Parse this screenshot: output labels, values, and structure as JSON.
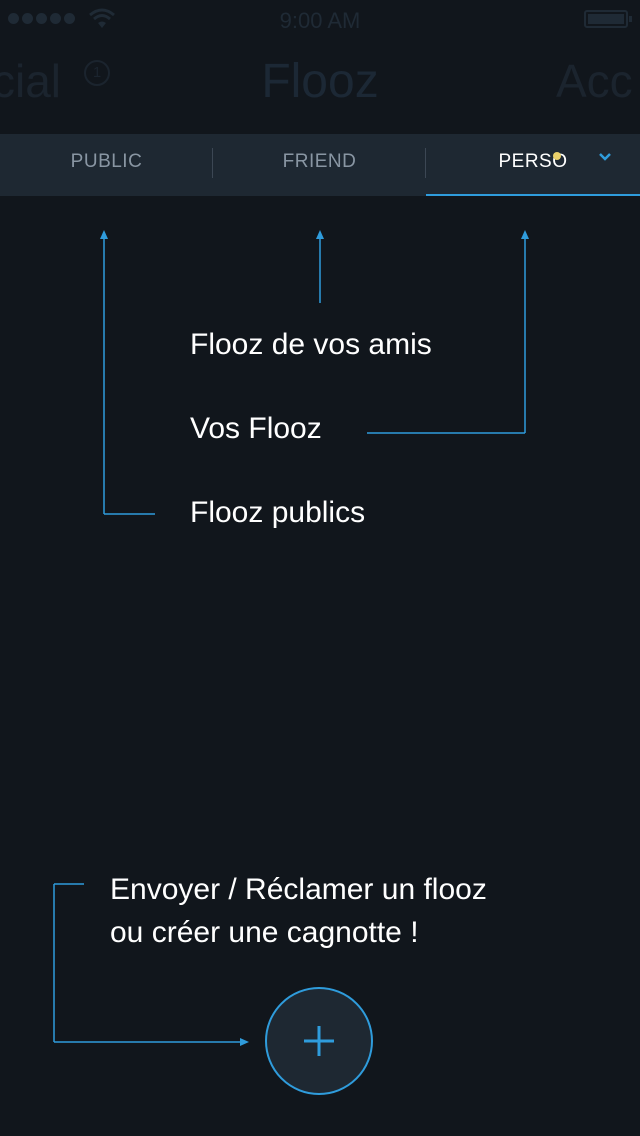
{
  "status_bar": {
    "time": "9:00 AM",
    "signal_icon": "signal-dots-icon",
    "wifi_icon": "wifi-icon",
    "battery_icon": "battery-icon"
  },
  "nav": {
    "left_partial": "cial",
    "left_badge": "1",
    "title": "Flooz",
    "right_partial": "Acc"
  },
  "tabs": [
    {
      "label": "PUBLIC",
      "active": false
    },
    {
      "label": "FRIEND",
      "active": false
    },
    {
      "label": "PERSO",
      "active": true
    }
  ],
  "tips": {
    "friends": "Flooz de vos amis",
    "yours": "Vos Flooz",
    "publics": "Flooz publics",
    "create_line1": "Envoyer / Réclamer un flooz",
    "create_line2": "ou créer une cagnotte !"
  },
  "fab_icon": "plus-icon",
  "colors": {
    "accent": "#2f9cdc",
    "background": "#11161c",
    "tab_bar": "#1e2832",
    "notification_dot": "#e9d06a"
  }
}
